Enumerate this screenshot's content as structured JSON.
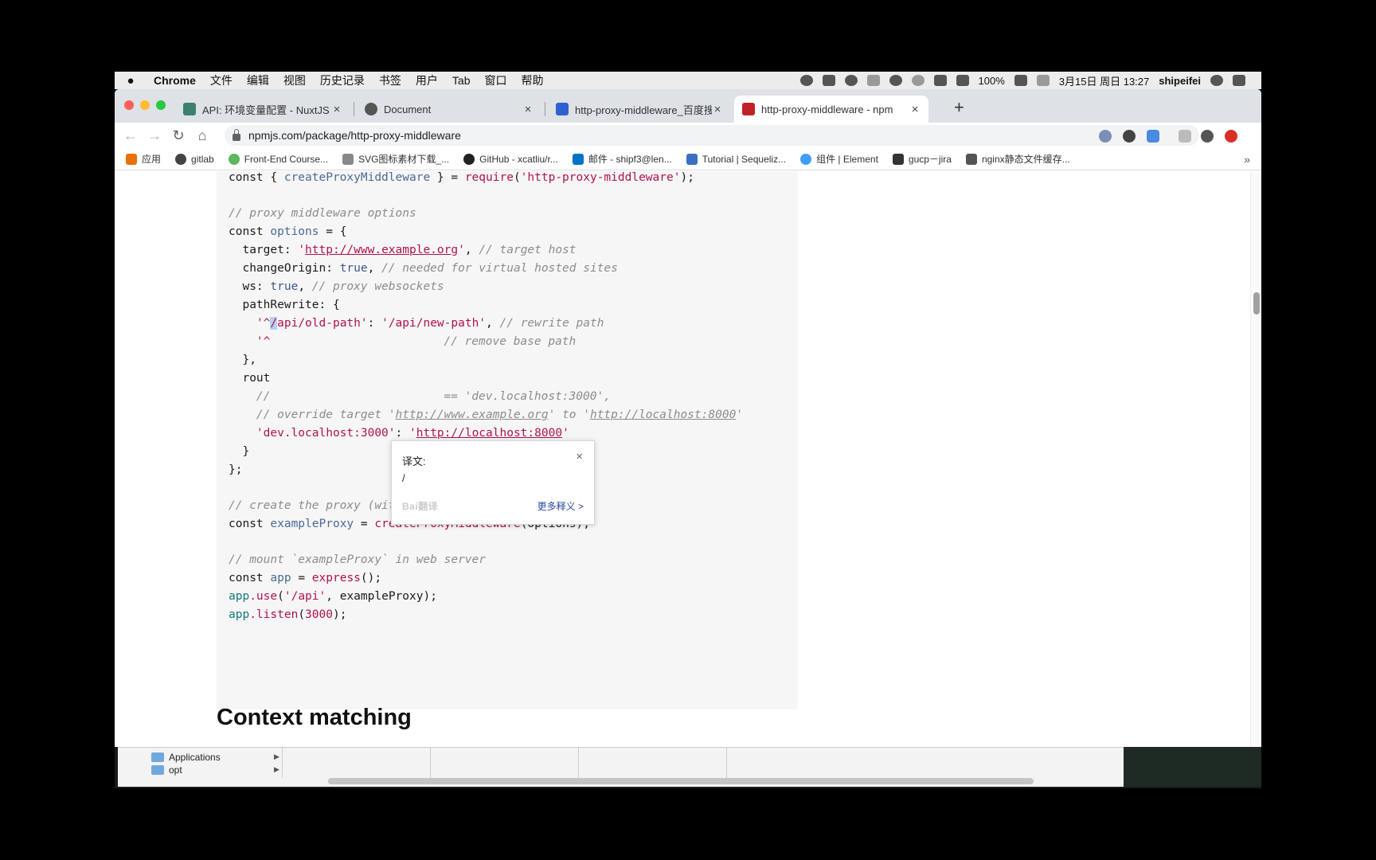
{
  "menubar": {
    "app": "Chrome",
    "items": [
      "文件",
      "编辑",
      "视图",
      "历史记录",
      "书签",
      "用户",
      "Tab",
      "窗口",
      "帮助"
    ],
    "battery": "100%",
    "datetime": "3月15日 周日 13:27",
    "user": "shipeifei"
  },
  "tabs": [
    {
      "title": "API: 环境变量配置 - NuxtJS",
      "favicon_color": "#3b8070"
    },
    {
      "title": "Document",
      "favicon_color": "#555555"
    },
    {
      "title": "http-proxy-middleware_百度搜",
      "favicon_color": "#3060d0"
    },
    {
      "title": "http-proxy-middleware - npm",
      "favicon_color": "#c12127"
    }
  ],
  "toolbar": {
    "url": "npmjs.com/package/http-proxy-middleware",
    "new_tab": "+",
    "back_icon": "←",
    "forward_icon": "→",
    "reload_icon": "↻",
    "home_icon": "⌂",
    "star_icon": "☆"
  },
  "bookmarks": [
    {
      "label": "应用",
      "color": "#e8710a"
    },
    {
      "label": "gitlab",
      "color": "#444444"
    },
    {
      "label": "Front-End Course...",
      "color": "#5cb85c"
    },
    {
      "label": "SVG图标素材下载_...",
      "color": "#888888"
    },
    {
      "label": "GitHub - xcatliu/r...",
      "color": "#222222"
    },
    {
      "label": "邮件 - shipf3@len...",
      "color": "#0072c6"
    },
    {
      "label": "Tutorial | Sequeliz...",
      "color": "#3b6fc3"
    },
    {
      "label": "组件 | Element",
      "color": "#409eff"
    },
    {
      "label": "gucp－jira",
      "color": "#333333"
    },
    {
      "label": "nginx静态文件缓存...",
      "color": "#555555"
    }
  ],
  "bookmarks_more": "»",
  "code": {
    "l1_a": "const { ",
    "l1_b": "createProxyMiddleware",
    "l1_c": " } = ",
    "l1_d": "require",
    "l1_e": "(",
    "l1_f": "'http-proxy-middleware'",
    "l1_g": ");",
    "l2": "// proxy middleware options",
    "l3_a": "const ",
    "l3_b": "options",
    "l3_c": " = {",
    "l4_a": "  target: ",
    "l4_b": "'",
    "l4_c": "http://www.example.org",
    "l4_d": "'",
    "l4_e": ", ",
    "l4_f": "// target host",
    "l5_a": "  changeOrigin: ",
    "l5_b": "true",
    "l5_c": ", ",
    "l5_d": "// needed for virtual hosted sites",
    "l6_a": "  ws: ",
    "l6_b": "true",
    "l6_c": ", ",
    "l6_d": "// proxy websockets",
    "l7": "  pathRewrite: {",
    "l8_a": "    '^",
    "l8_b": "/",
    "l8_c": "api/old-path'",
    "l8_d": ": ",
    "l8_e": "'/api/new-path'",
    "l8_f": ", ",
    "l8_g": "// rewrite path",
    "l9_a": "    '^",
    "l9_b": "// remove base path",
    "l10": "  },",
    "l11": "  rout",
    "l12_a": "    //",
    "l12_b": "== 'dev.localhost:3000',",
    "l13_a": "    // override target '",
    "l13_b": "http://www.example.org",
    "l13_c": "' to '",
    "l13_d": "http://localhost:8000",
    "l13_e": "'",
    "l14_a": "    ",
    "l14_b": "'dev.localhost:3000'",
    "l14_c": ": ",
    "l14_d": "'",
    "l14_e": "http://localhost:8000",
    "l14_f": "'",
    "l15": "  }",
    "l16": "};",
    "l17": "// create the proxy (without context)",
    "l18_a": "const ",
    "l18_b": "exampleProxy",
    "l18_c": " = ",
    "l18_d": "createProxyMiddleware",
    "l18_e": "(options);",
    "l19": "// mount `exampleProxy` in web server",
    "l20_a": "const ",
    "l20_b": "app",
    "l20_c": " = ",
    "l20_d": "express",
    "l20_e": "();",
    "l21_a": "app",
    "l21_b": ".use",
    "l21_c": "(",
    "l21_d": "'/api'",
    "l21_e": ", exampleProxy);",
    "l22_a": "app",
    "l22_b": ".listen",
    "l22_c": "(",
    "l22_d": "3000",
    "l22_e": ");"
  },
  "heading": "Context matching",
  "popup": {
    "label": "译文:",
    "result": "/",
    "close": "×",
    "logo": "Bai翻译",
    "more": "更多释义 >"
  },
  "finder": {
    "items": [
      "Applications",
      "opt"
    ]
  }
}
